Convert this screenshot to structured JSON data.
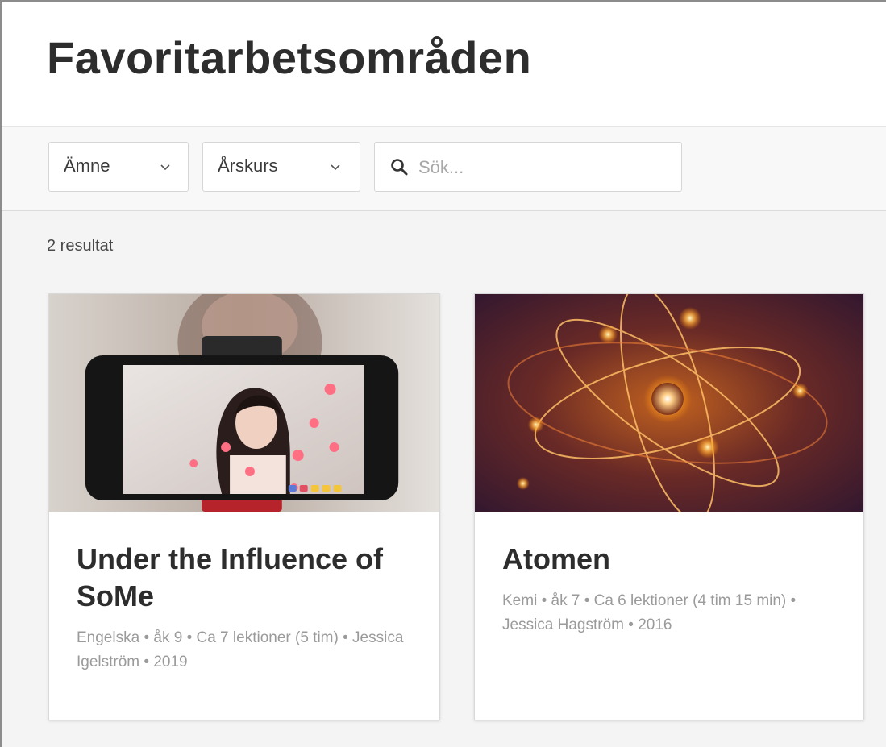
{
  "page": {
    "title": "Favoritarbetsområden"
  },
  "filters": {
    "subject_label": "Ämne",
    "grade_label": "Årskurs",
    "search_placeholder": "Sök..."
  },
  "results": {
    "count_text": "2 resultat",
    "cards": [
      {
        "title": "Under the Influence of SoMe",
        "meta": "Engelska • åk 9 • Ca 7 lektioner (5 tim) • Jessica Igelström • 2019",
        "image": "person-filming-selfie-video-on-smartphone"
      },
      {
        "title": "Atomen",
        "meta": "Kemi • åk 7 • Ca 6 lektioner (4 tim 15 min) • Jessica Hagström • 2016",
        "image": "glowing-atom-with-orbits"
      }
    ]
  },
  "icons": {
    "chevron": "chevron-down-icon",
    "search": "search-icon"
  },
  "colors": {
    "title": "#2d2d2d",
    "meta": "#9a9a9a",
    "content_background": "#f4f4f4",
    "filter_bar_background": "#f8f8f8"
  }
}
